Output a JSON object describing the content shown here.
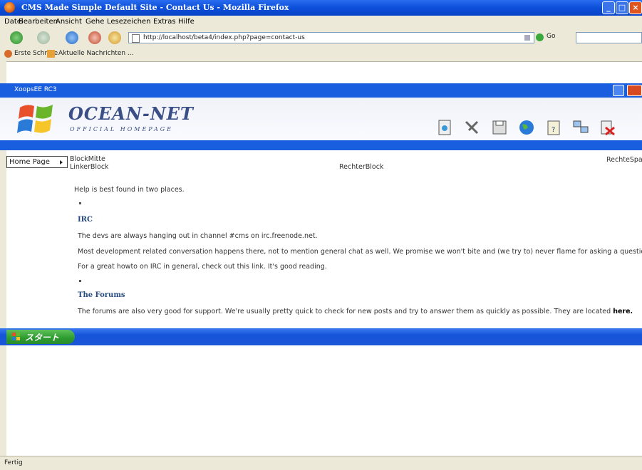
{
  "window": {
    "title": "CMS Made Simple Default Site - Contact Us - Mozilla Firefox"
  },
  "menu": [
    "Datei",
    "Bearbeiten",
    "Ansicht",
    "Gehe",
    "Lesezeichen",
    "Extras",
    "Hilfe"
  ],
  "nav": {
    "url": "http://localhost/beta4/index.php?page=contact-us",
    "go_label": "Go"
  },
  "bookmarks": [
    "Erste Schritte",
    "Aktuelle Nachrichten ..."
  ],
  "xoops_bar": "XoopsEE RC3",
  "logo": {
    "main": "OCEAN-NET",
    "sub": "OFFICIAL HOMEPAGE"
  },
  "content": {
    "home_page": "Home Page",
    "block_mitte": "BlockMitte",
    "linker_block": "LinkerBlock",
    "rechter_block": "RechterBlock",
    "rechte_spalte": "RechteSpal",
    "intro": "Help is best found in two places.",
    "irc_heading": "IRC",
    "irc_line1": "The devs are always hanging out in channel #cms on irc.freenode.net.",
    "irc_line2": "Most development related conversation happens there, not to mention general chat as well. We promise we won't bite and (we try to) never flame for asking a question.",
    "irc_line3": "For a great howto on IRC in general, check out this link. It's good reading.",
    "forums_heading": "The Forums",
    "forums_line_pre": "The forums are also very good for support. We're usually pretty quick to check for new posts and try to answer them as quickly as possible. They are located ",
    "forums_link": "here."
  },
  "taskbar": {
    "start_label": "スタート"
  },
  "status": "Fertig",
  "colors": {
    "xp_blue": "#1a5ee0",
    "start_green": "#2c9b2e",
    "heading": "#244a80"
  }
}
